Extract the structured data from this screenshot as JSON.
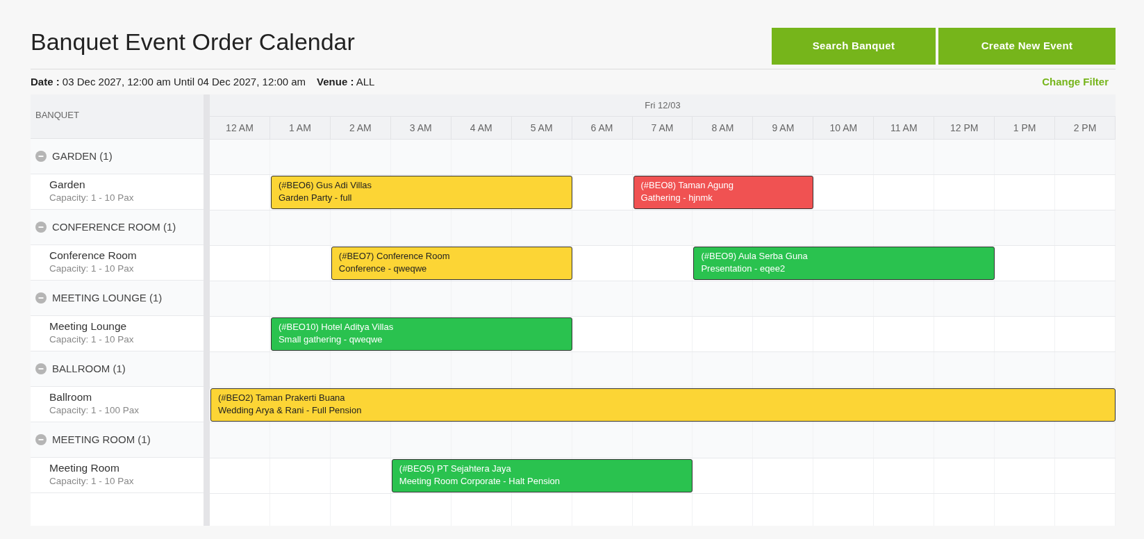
{
  "title": "Banquet Event Order Calendar",
  "buttons": [
    "Search Banquet",
    "Create New Event"
  ],
  "filter": {
    "date_text": "**Date :** 03 Dec 2027, 12:00 am Until 04 Dec 2027, 12:00 am",
    "venue_text": "**Venue :** ALL",
    "change_link": "Change Filter"
  },
  "table": {
    "resource_heading": "BANQUET",
    "day_label": "Fri 12/03",
    "hours": [
      "12 AM",
      "1 AM",
      "2 AM",
      "3 AM",
      "4 AM",
      "5 AM",
      "6 AM",
      "7 AM",
      "8 AM",
      "9 AM",
      "10 AM",
      "11 AM",
      "12 PM",
      "1 PM",
      "2 PM"
    ],
    "groups": [
      {
        "label": "GARDEN (1)",
        "expanded": true,
        "resources": [
          {
            "name": "Garden",
            "capacity": "Capacity: 1 - 10 Pax",
            "cells": [
              {
                "kind": "empty"
              },
              {
                "kind": "event",
                "title": "(#BEO6) Gus Adi Villas",
                "subtitle": "Garden Party - full",
                "color": "#fcd535"
              },
              {
                "kind": "continued"
              },
              {
                "kind": "continued"
              },
              {
                "kind": "continued"
              },
              {
                "kind": "continued"
              },
              {
                "kind": "empty"
              },
              {
                "kind": "event",
                "title": "(#BEO8) Taman Agung",
                "subtitle": "Gathering - hjnmk",
                "color": "#f05252"
              },
              {
                "kind": "continued"
              },
              {
                "kind": "continued"
              },
              {
                "kind": "empty"
              },
              {
                "kind": "empty"
              },
              {
                "kind": "empty"
              },
              {
                "kind": "empty"
              },
              {
                "kind": "empty"
              }
            ]
          }
        ]
      },
      {
        "label": "CONFERENCE ROOM (1)",
        "expanded": true,
        "resources": [
          {
            "name": "Conference Room",
            "capacity": "Capacity: 1 - 10 Pax",
            "cells": [
              {
                "kind": "empty"
              },
              {
                "kind": "empty"
              },
              {
                "kind": "event",
                "title": "(#BEO7) Conference Room",
                "subtitle": "Conference - qweqwe",
                "color": "#fcd535"
              },
              {
                "kind": "continued"
              },
              {
                "kind": "continued"
              },
              {
                "kind": "continued"
              },
              {
                "kind": "empty"
              },
              {
                "kind": "empty"
              },
              {
                "kind": "event",
                "title": "(#BEO9) Aula Serba Guna",
                "subtitle": "Presentation - eqee2",
                "color": "#2ac24f"
              },
              {
                "kind": "continued"
              },
              {
                "kind": "continued"
              },
              {
                "kind": "continued"
              },
              {
                "kind": "continued"
              },
              {
                "kind": "empty"
              },
              {
                "kind": "empty"
              }
            ]
          }
        ]
      },
      {
        "label": "MEETING LOUNGE (1)",
        "expanded": true,
        "resources": [
          {
            "name": "Meeting Lounge",
            "capacity": "Capacity: 1 - 10 Pax",
            "cells": [
              {
                "kind": "empty"
              },
              {
                "kind": "event",
                "title": "(#BEO10) Hotel Aditya Villas",
                "subtitle": "Small gathering - qweqwe",
                "color": "#2ac24f"
              },
              {
                "kind": "continued"
              },
              {
                "kind": "continued"
              },
              {
                "kind": "continued"
              },
              {
                "kind": "continued"
              },
              {
                "kind": "empty"
              },
              {
                "kind": "empty"
              },
              {
                "kind": "empty"
              },
              {
                "kind": "empty"
              },
              {
                "kind": "empty"
              },
              {
                "kind": "empty"
              },
              {
                "kind": "empty"
              },
              {
                "kind": "empty"
              },
              {
                "kind": "empty"
              }
            ]
          }
        ]
      },
      {
        "label": "BALLROOM (1)",
        "expanded": true,
        "resources": [
          {
            "name": "Ballroom",
            "capacity": "Capacity: 1 - 100 Pax",
            "cells": [
              {
                "kind": "event",
                "title": "(#BEO2) Taman Prakerti Buana",
                "subtitle": "Wedding Arya & Rani - Full Pension",
                "color": "#fcd535"
              },
              {
                "kind": "continued"
              },
              {
                "kind": "continued"
              },
              {
                "kind": "continued"
              },
              {
                "kind": "continued"
              },
              {
                "kind": "continued"
              },
              {
                "kind": "continued"
              },
              {
                "kind": "continued"
              },
              {
                "kind": "continued"
              },
              {
                "kind": "continued"
              },
              {
                "kind": "continued"
              },
              {
                "kind": "continued"
              },
              {
                "kind": "continued"
              },
              {
                "kind": "continued"
              },
              {
                "kind": "continued"
              }
            ]
          }
        ]
      },
      {
        "label": "MEETING ROOM (1)",
        "expanded": true,
        "resources": [
          {
            "name": "Meeting Room",
            "capacity": "Capacity: 1 - 10 Pax",
            "cells": [
              {
                "kind": "empty"
              },
              {
                "kind": "empty"
              },
              {
                "kind": "empty"
              },
              {
                "kind": "event",
                "title": "(#BEO5) PT Sejahtera Jaya",
                "subtitle": "Meeting Room Corporate - Halt Pension",
                "color": "#2ac24f"
              },
              {
                "kind": "continued"
              },
              {
                "kind": "continued"
              },
              {
                "kind": "continued"
              },
              {
                "kind": "continued"
              },
              {
                "kind": "empty"
              },
              {
                "kind": "empty"
              },
              {
                "kind": "empty"
              },
              {
                "kind": "empty"
              },
              {
                "kind": "empty"
              },
              {
                "kind": "empty"
              },
              {
                "kind": "empty"
              }
            ]
          }
        ]
      }
    ]
  }
}
